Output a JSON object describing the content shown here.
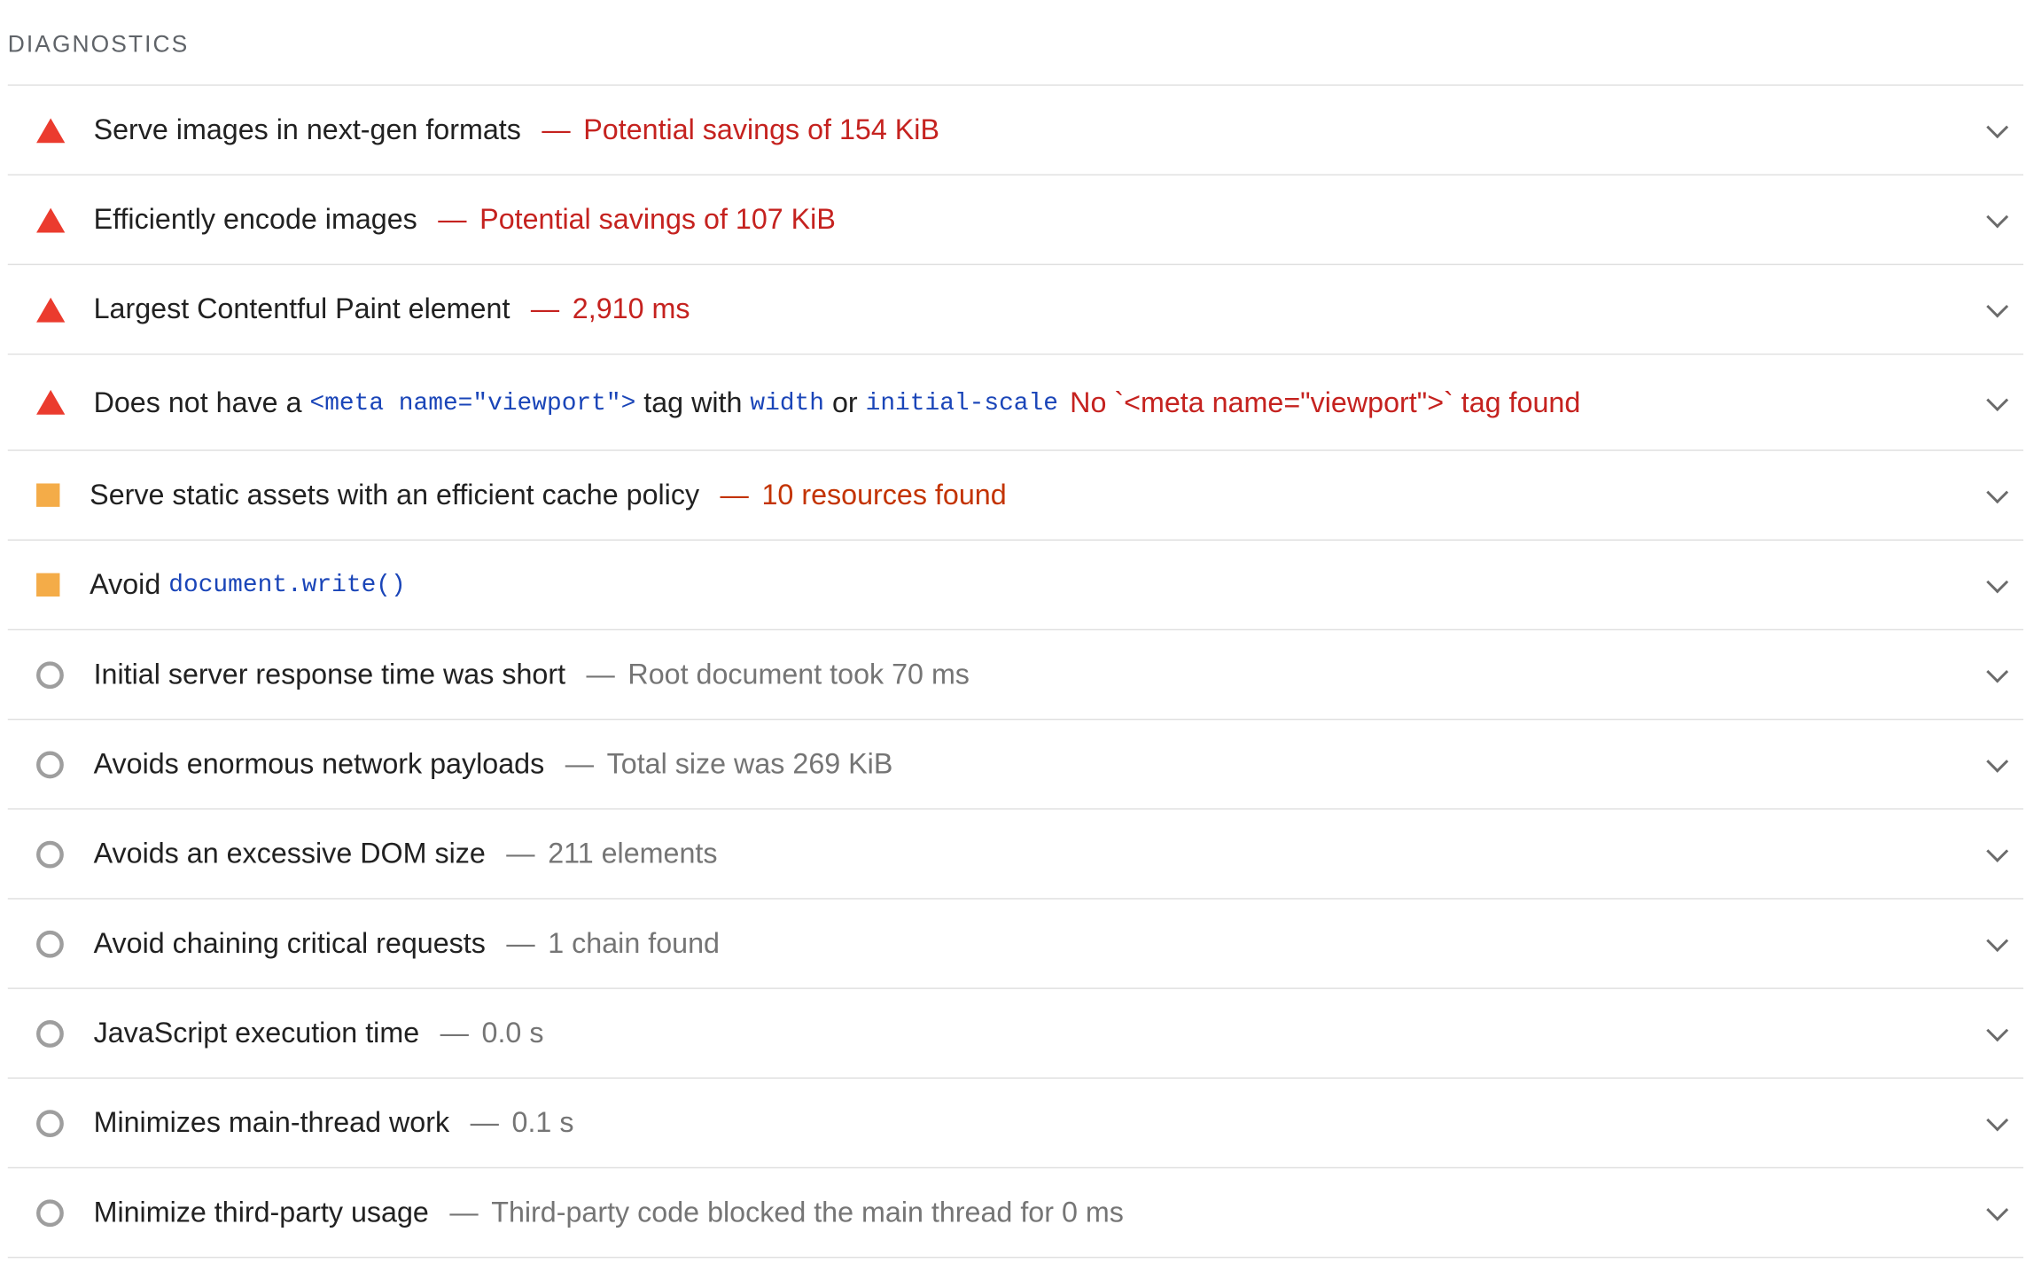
{
  "section": {
    "title": "DIAGNOSTICS"
  },
  "audits": [
    {
      "title": "Serve images in next-gen formats",
      "separator": "—",
      "display": "Potential savings of 154 KiB",
      "status": "fail",
      "icon": "red-triangle-icon"
    },
    {
      "title": "Efficiently encode images",
      "separator": "—",
      "display": "Potential savings of 107 KiB",
      "status": "fail",
      "icon": "red-triangle-icon"
    },
    {
      "title": "Largest Contentful Paint element",
      "separator": "—",
      "display": "2,910 ms",
      "status": "fail",
      "icon": "red-triangle-icon"
    },
    {
      "title_prefix": "Does not have a ",
      "code1": "<meta name=\"viewport\">",
      "title_mid1": " tag with ",
      "code2": "width",
      "title_mid2": " or ",
      "code3": "initial-scale",
      "display": "No `<meta name=\"viewport\">` tag found",
      "status": "fail",
      "icon": "red-triangle-icon"
    },
    {
      "title": "Serve static assets with an efficient cache policy",
      "separator": "—",
      "display": "10 resources found",
      "status": "average",
      "icon": "orange-square-icon"
    },
    {
      "title_prefix": "Avoid ",
      "code1": "document.write()",
      "status": "average",
      "icon": "orange-square-icon"
    },
    {
      "title": "Initial server response time was short",
      "separator": "—",
      "display": "Root document took 70 ms",
      "status": "pass",
      "icon": "gray-circle-icon"
    },
    {
      "title": "Avoids enormous network payloads",
      "separator": "—",
      "display": "Total size was 269 KiB",
      "status": "pass",
      "icon": "gray-circle-icon"
    },
    {
      "title": "Avoids an excessive DOM size",
      "separator": "—",
      "display": "211 elements",
      "status": "pass",
      "icon": "gray-circle-icon"
    },
    {
      "title": "Avoid chaining critical requests",
      "separator": "—",
      "display": "1 chain found",
      "status": "pass",
      "icon": "gray-circle-icon"
    },
    {
      "title": "JavaScript execution time",
      "separator": "—",
      "display": "0.0 s",
      "status": "pass",
      "icon": "gray-circle-icon"
    },
    {
      "title": "Minimizes main-thread work",
      "separator": "—",
      "display": "0.1 s",
      "status": "pass",
      "icon": "gray-circle-icon"
    },
    {
      "title": "Minimize third-party usage",
      "separator": "—",
      "display": "Third-party code blocked the main thread for 0 ms",
      "status": "pass",
      "icon": "gray-circle-icon"
    }
  ],
  "colors": {
    "fail": "#eb3b2e",
    "average": "#f4ac48",
    "pass": "#9e9e9e",
    "fail_text": "#c5221f",
    "average_text": "#c33300",
    "pass_text": "#757575",
    "code_text": "#1a45b8"
  }
}
